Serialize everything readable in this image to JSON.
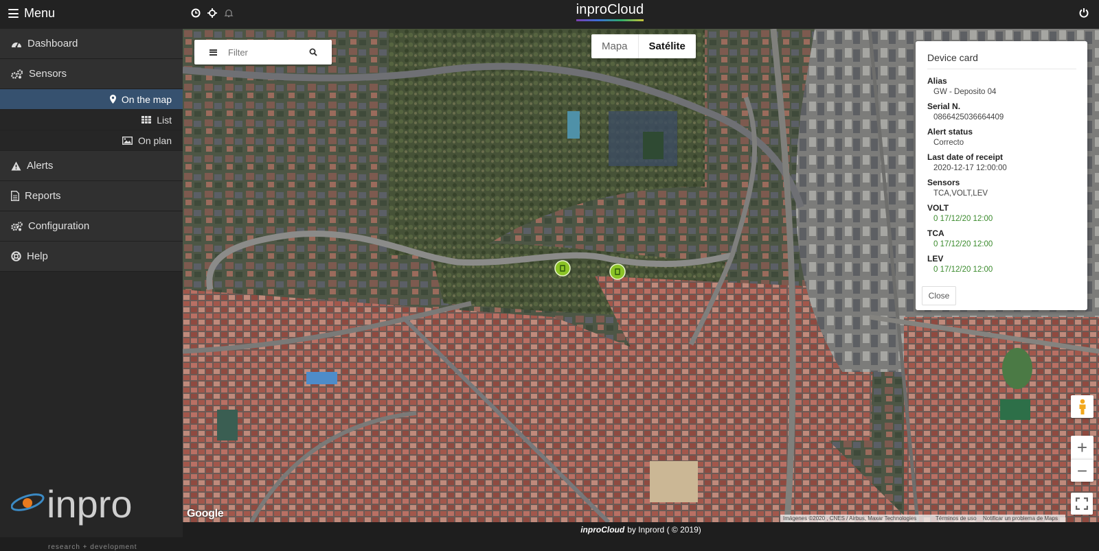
{
  "topbar": {
    "menu_label": "Menu",
    "brand": "inproCloud",
    "icons": [
      "clock-icon",
      "crosshair-icon",
      "bell-icon",
      "power-icon"
    ]
  },
  "sidebar": {
    "items": [
      {
        "label": "Dashboard",
        "icon": "dashboard-icon"
      },
      {
        "label": "Sensors",
        "icon": "sensors-icon"
      },
      {
        "label": "Alerts",
        "icon": "warning-icon"
      },
      {
        "label": "Reports",
        "icon": "document-icon"
      },
      {
        "label": "Configuration",
        "icon": "gears-icon"
      },
      {
        "label": "Help",
        "icon": "lifebuoy-icon"
      }
    ],
    "sensor_subitems": [
      {
        "label": "On the map",
        "icon": "map-marker-icon",
        "active": true
      },
      {
        "label": "List",
        "icon": "table-icon",
        "active": false
      },
      {
        "label": "On plan",
        "icon": "image-icon",
        "active": false
      }
    ],
    "logo_text": "inpro",
    "logo_subtitle": "research + development"
  },
  "map": {
    "filter_placeholder": "Filter",
    "map_type_options": [
      "Mapa",
      "Satélite"
    ],
    "selected_map_type": "Satélite",
    "google_label": "Google",
    "attribution": {
      "imagery": "Imágenes ©2020 , CNES / Airbus, Maxar Technologies",
      "terms": "Términos de uso",
      "report": "Notificar un problema de Maps"
    },
    "zoom_in": "+",
    "zoom_out": "−"
  },
  "device_card": {
    "title": "Device card",
    "fields": [
      {
        "label": "Alias",
        "value": "GW - Deposito 04",
        "highlight": false
      },
      {
        "label": "Serial N.",
        "value": "0866425036664409",
        "highlight": false
      },
      {
        "label": "Alert status",
        "value": "Correcto",
        "highlight": false
      },
      {
        "label": "Last date of receipt",
        "value": "2020-12-17 12:00:00",
        "highlight": false
      },
      {
        "label": "Sensors",
        "value": "TCA,VOLT,LEV",
        "highlight": false
      },
      {
        "label": "VOLT",
        "value": "0 17/12/20 12:00",
        "highlight": true
      },
      {
        "label": "TCA",
        "value": "0 17/12/20 12:00",
        "highlight": true
      },
      {
        "label": "LEV",
        "value": "0 17/12/20 12:00",
        "highlight": true
      }
    ],
    "close_label": "Close",
    "highlight_color": "#3a8a2c"
  },
  "footer": {
    "brand": "inproCloud",
    "text": "by Inprord ( © 2019)"
  },
  "colors": {
    "active_nav": "#36516f",
    "marker": "#8bc326"
  }
}
